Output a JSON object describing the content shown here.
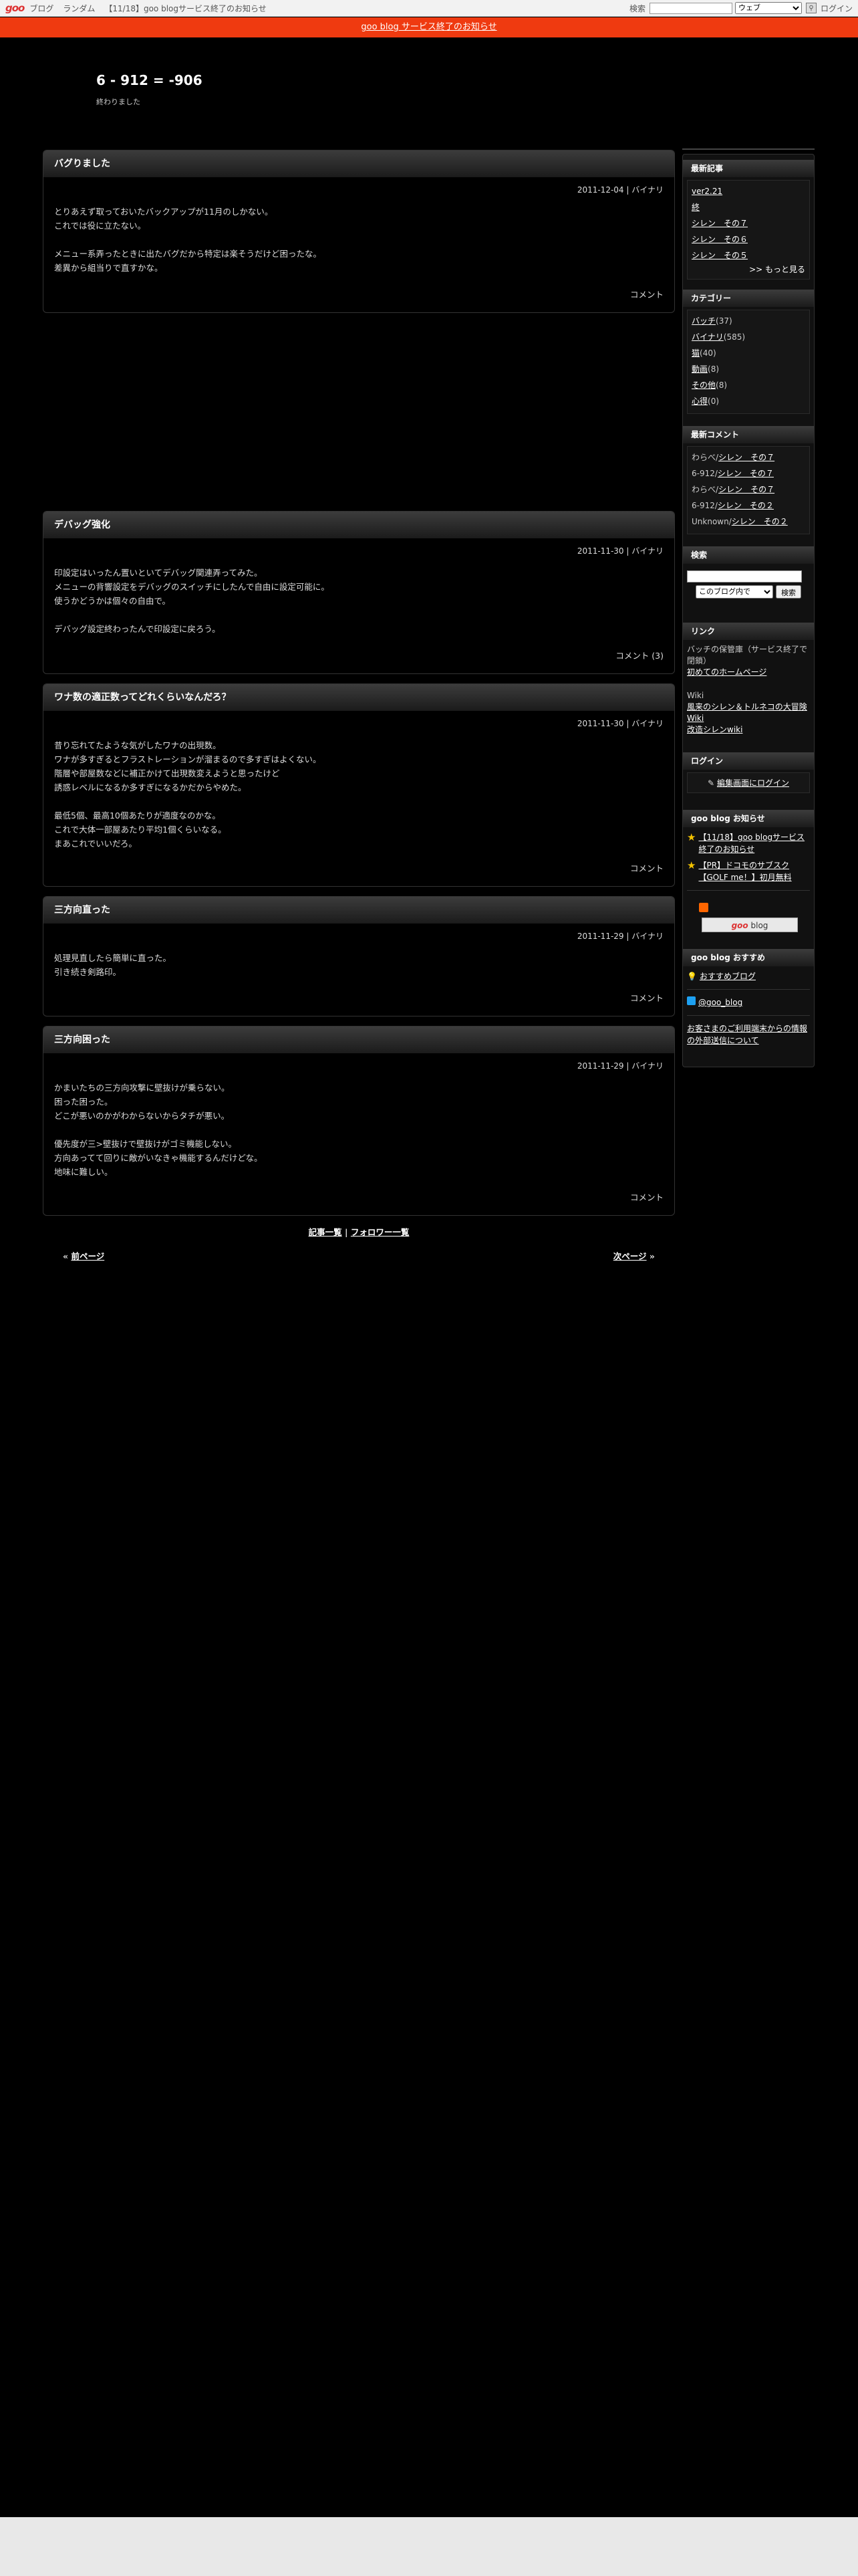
{
  "toolbar": {
    "logo": "goo",
    "links": [
      "ブログ",
      "ランダム",
      "【11/18】goo blogサービス終了のお知らせ"
    ],
    "search_label": "検索",
    "search_scope": "ウェブ",
    "login": "ログイン"
  },
  "notice": "goo blog サービス終了のお知らせ",
  "blog": {
    "title": "6 - 912 = -906",
    "description": "終わりました"
  },
  "entries": [
    {
      "title": "バグりました",
      "date": "2011-12-04",
      "sep": " | ",
      "author": "バイナリ",
      "lines": [
        "とりあえず取っておいたバックアップが11月のしかない。",
        "これでは役に立たない。",
        "",
        "メニュー系弄ったときに出たバグだから特定は楽そうだけど困ったな。",
        "差異から組当りで直すかな。"
      ],
      "footer": "コメント"
    },
    {
      "title": "デバッグ強化",
      "date": "2011-11-30",
      "sep": " | ",
      "author": "バイナリ",
      "lines": [
        "印設定はいったん置いといてデバッグ関連弄ってみた。",
        "メニューの背響設定をデバッグのスイッチにしたんで自由に設定可能に。",
        "使うかどうかは個々の自由で。",
        "",
        "デバッグ設定終わったんで印設定に戻ろう。"
      ],
      "footer": "コメント (3)"
    },
    {
      "title": "ワナ数の適正数ってどれくらいなんだろ？",
      "date": "2011-11-30",
      "sep": " | ",
      "author": "バイナリ",
      "lines": [
        "昔り忘れてたような気がしたワナの出現数。",
        "ワナが多すぎるとフラストレーションが溜まるので多すぎはよくない。",
        "階層や部屋数などに補正かけて出現数変えようと思ったけど",
        "誘惑レベルになるか多すぎになるかだからやめた。",
        "",
        "最低5個、最高10個あたりが適度なのかな。",
        "これで大体一部屋あたり平均1個くらいなる。",
        "まあこれでいいだろ。"
      ],
      "footer": "コメント"
    },
    {
      "title": "三方向直った",
      "date": "2011-11-29",
      "sep": " | ",
      "author": "バイナリ",
      "lines": [
        "処理見直したら簡単に直った。",
        "引き続き剣路印。"
      ],
      "footer": "コメント"
    },
    {
      "title": "三方向困った",
      "date": "2011-11-29",
      "sep": " | ",
      "author": "バイナリ",
      "lines": [
        "かまいたちの三方向攻撃に壁抜けが乗らない。",
        "困った困った。",
        "どこが悪いのかがわからないからタチが悪い。",
        "",
        "優先度が三>壁抜けで壁抜けがゴミ機能しない。",
        "方向あってて回りに敵がいなきゃ機能するんだけどな。",
        "地味に難しい。"
      ],
      "footer": "コメント"
    }
  ],
  "list_links": {
    "entries": "記事一覧",
    "sep": " | ",
    "followers": "フォロワー一覧"
  },
  "pager": {
    "prev_mark": "« ",
    "prev": "前ページ",
    "next": "次ページ",
    "next_mark": " »"
  },
  "sidebar": {
    "recent": {
      "title": "最新記事",
      "items": [
        "ver2.21",
        "終",
        "シレン　その７",
        "シレン　その６",
        "シレン　その５"
      ],
      "more": ">> もっと見る"
    },
    "categories": {
      "title": "カテゴリー",
      "items": [
        {
          "name": "バッチ",
          "count": "(37)"
        },
        {
          "name": "バイナリ",
          "count": "(585)"
        },
        {
          "name": "猫",
          "count": "(40)"
        },
        {
          "name": "動画",
          "count": "(8)"
        },
        {
          "name": "その他",
          "count": "(8)"
        },
        {
          "name": "心得",
          "count": "(0)"
        }
      ]
    },
    "comments": {
      "title": "最新コメント",
      "items": [
        {
          "who": "わらべ",
          "sep": "/",
          "post": "シレン　その７"
        },
        {
          "who": "6-912",
          "sep": "/",
          "post": "シレン　その７"
        },
        {
          "who": "わらべ",
          "sep": "/",
          "post": "シレン　その７"
        },
        {
          "who": "6-912",
          "sep": "/",
          "post": "シレン　その２"
        },
        {
          "who": "Unknown",
          "sep": "/",
          "post": "シレン　その２"
        }
      ]
    },
    "search": {
      "title": "検索",
      "scope": "このブログ内で",
      "button": "検索"
    },
    "links": {
      "title": "リンク",
      "note": "バッチの保管庫（サービス終了で閉鎖）",
      "link1": "初めてのホームページ",
      "wiki_label": "Wiki",
      "link2": "風来のシレン＆トルネコの大冒険 Wiki",
      "link3": "改造シレンwiki"
    },
    "login": {
      "title": "ログイン",
      "link": "編集画面にログイン"
    },
    "news": {
      "title": "goo blog お知らせ",
      "items": [
        "【11/18】goo blogサービス終了のお知らせ",
        "【PR】ドコモのサブスク【GOLF me！】初月無料"
      ]
    },
    "goo_badge_g": "goo",
    "goo_badge_rest": " blog",
    "recommend": {
      "title": "goo blog おすすめ",
      "item": "おすすめブログ",
      "twitter": "@goo_blog",
      "privacy": "お客さまのご利用端末からの情報の外部送信について"
    }
  },
  "colors": {
    "background": "#000000",
    "notice_bar": "#ef3a10",
    "title_gradient_top": "#3c3c3c",
    "title_gradient_bottom": "#1b1b1b"
  }
}
